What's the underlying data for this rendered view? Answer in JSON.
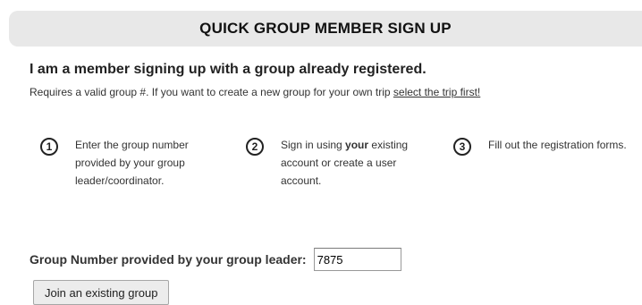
{
  "header": {
    "title": "QUICK GROUP MEMBER SIGN UP"
  },
  "intro": {
    "heading": "I am a member signing up with a group already registered.",
    "text_prefix": "Requires a valid group #. If you want to create a new group for your own trip ",
    "link_label": "select the trip first!"
  },
  "steps": [
    {
      "number": "1",
      "text": "Enter the group number provided by your group leader/coordinator."
    },
    {
      "number": "2",
      "text_before": "Sign in using ",
      "text_bold": "your",
      "text_after": " existing account or create a user account."
    },
    {
      "number": "3",
      "text": "Fill out the registration forms."
    }
  ],
  "group_form": {
    "label": "Group Number provided by your group leader:",
    "value": "7875",
    "button_label": "Join an existing group"
  }
}
